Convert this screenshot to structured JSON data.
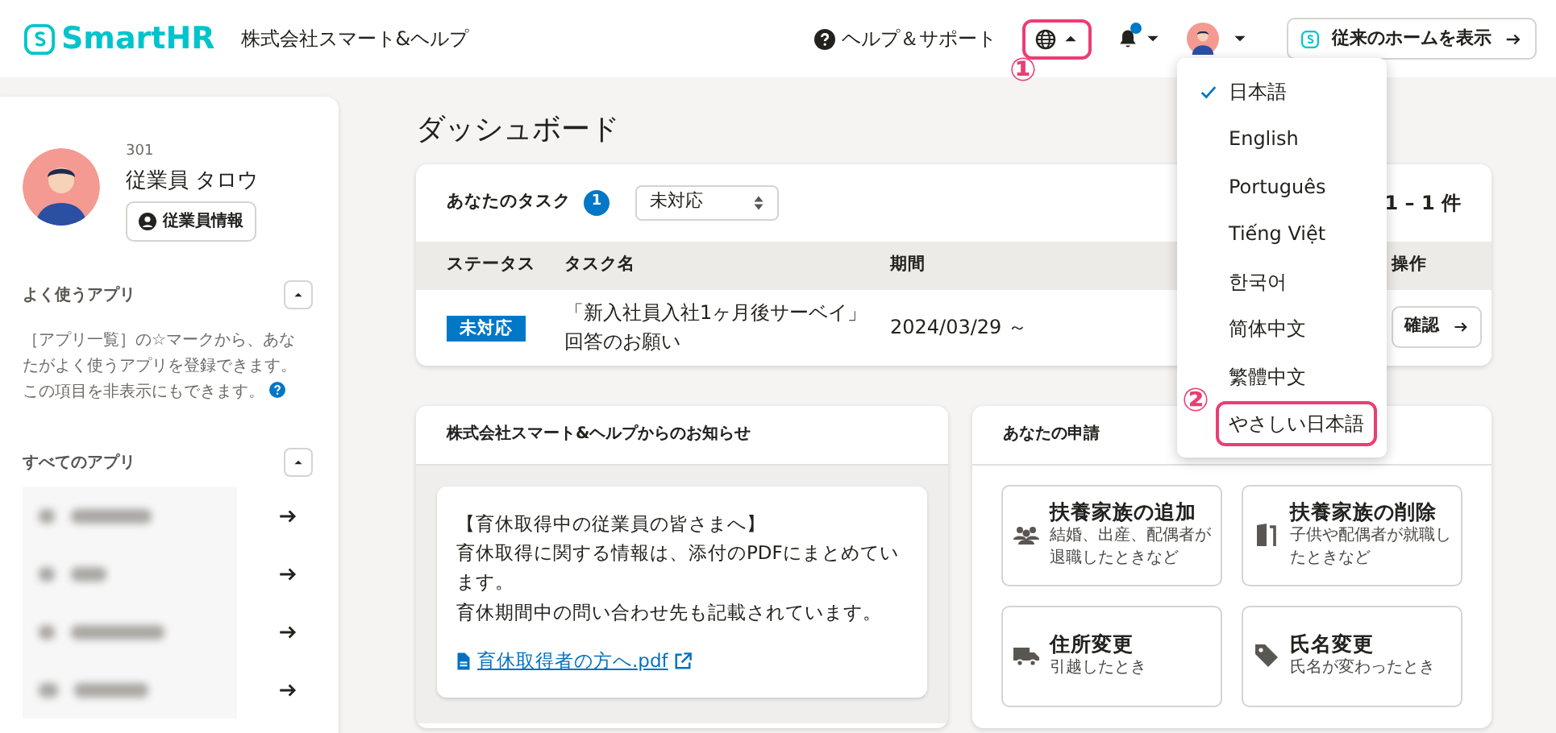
{
  "header": {
    "logo": "SmartHR",
    "company": "株式会社スマート&ヘルプ",
    "help": "ヘルプ＆サポート",
    "language_button": {
      "expanded": true,
      "highlighted": true,
      "annotation": "①"
    },
    "notifications": {
      "unread": true
    },
    "classic_home_button": "従来のホームを表示"
  },
  "language_menu": {
    "items": [
      {
        "label": "日本語",
        "selected": true,
        "highlighted": false
      },
      {
        "label": "English",
        "selected": false,
        "highlighted": false
      },
      {
        "label": "Português",
        "selected": false,
        "highlighted": false
      },
      {
        "label": "Tiếng Việt",
        "selected": false,
        "highlighted": false
      },
      {
        "label": "한국어",
        "selected": false,
        "highlighted": false
      },
      {
        "label": "简体中文",
        "selected": false,
        "highlighted": false
      },
      {
        "label": "繁體中文",
        "selected": false,
        "highlighted": false
      },
      {
        "label": "やさしい日本語",
        "selected": false,
        "highlighted": true,
        "annotation": "②"
      }
    ]
  },
  "sidebar": {
    "employee_number": "301",
    "employee_name": "従業員 タロウ",
    "profile_button": "従業員情報",
    "favorites": {
      "title": "よく使うアプリ",
      "expanded": true,
      "description": "［アプリ一覧］の☆マークから、あなたがよく使うアプリを登録できます。この項目を非表示にもできます。"
    },
    "all_apps": {
      "title": "すべてのアプリ",
      "expanded": true,
      "items": [
        {
          "kind": "redacted"
        },
        {
          "kind": "redacted"
        },
        {
          "kind": "redacted"
        },
        {
          "kind": "redacted"
        }
      ]
    }
  },
  "page_title": "ダッシュボード",
  "tasks": {
    "title": "あなたのタスク",
    "count": "1",
    "filter": "未対応",
    "pager": "1 – 1 件",
    "columns": [
      "ステータス",
      "タスク名",
      "期間",
      "操作"
    ],
    "rows": [
      {
        "status": "未対応",
        "name_lines": [
          "「新入社員入社1ヶ月後サーベイ」",
          "回答のお願い"
        ],
        "period": "2024/03/29 ～",
        "action": "確認"
      }
    ]
  },
  "notices": {
    "title": "株式会社スマート&ヘルプからのお知らせ",
    "items": [
      {
        "lines": [
          "【育休取得中の従業員の皆さまへ】",
          "育休取得に関する情報は、添付のPDFにまとめています。",
          "育休期間中の問い合わせ先も記載されています。"
        ],
        "attachment": "育休取得者の方へ.pdf"
      }
    ]
  },
  "applications": {
    "title": "あなたの申請",
    "items": [
      {
        "kind": "family-add",
        "title": "扶養家族の追加",
        "description": "結婚、出産、配偶者が退職したときなど"
      },
      {
        "kind": "family-remove",
        "title": "扶養家族の削除",
        "description": "子供や配偶者が就職したときなど"
      },
      {
        "kind": "address",
        "title": "住所変更",
        "description": "引越したとき"
      },
      {
        "kind": "name",
        "title": "氏名変更",
        "description": "氏名が変わったとき"
      }
    ]
  }
}
